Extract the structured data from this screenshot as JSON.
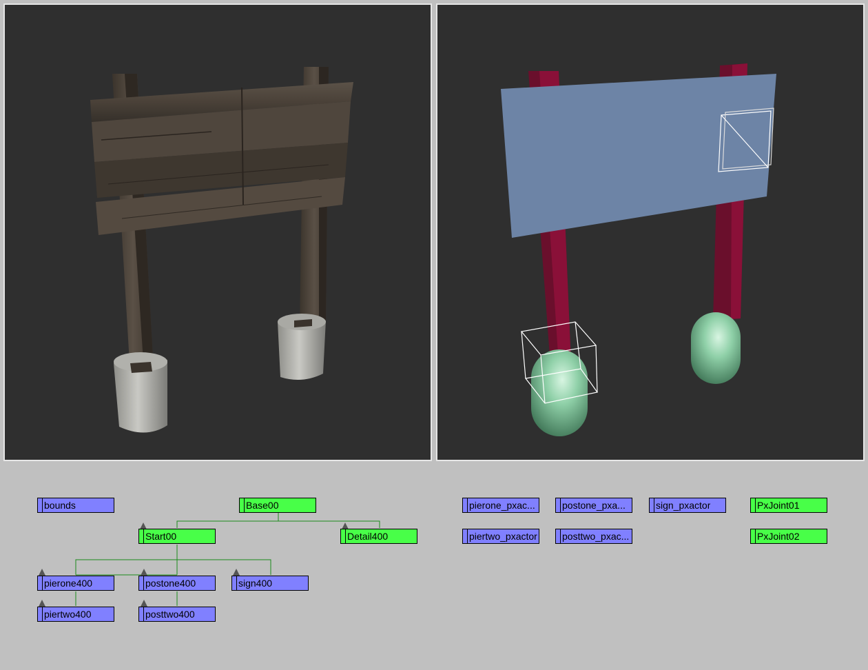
{
  "viewports": {
    "left": {
      "name": "textured-sign-model",
      "shading": "textured"
    },
    "right": {
      "name": "physics-proxy-model",
      "shading": "flat",
      "colors": {
        "panel": "#6d84a6",
        "posts": "#6a0f2c",
        "capsules": "#8fd0a8",
        "selection": "#ffffff"
      }
    }
  },
  "schematic": {
    "hierarchy": [
      {
        "id": "bounds",
        "label": "bounds",
        "type": "blue"
      },
      {
        "id": "base00",
        "label": "Base00",
        "type": "green"
      },
      {
        "id": "start00",
        "label": "Start00",
        "type": "green"
      },
      {
        "id": "detail400",
        "label": "Detail400",
        "type": "green"
      },
      {
        "id": "pierone400",
        "label": "pierone400",
        "type": "blue"
      },
      {
        "id": "postone400",
        "label": "postone400",
        "type": "blue"
      },
      {
        "id": "sign400",
        "label": "sign400",
        "type": "blue"
      },
      {
        "id": "piertwo400",
        "label": "piertwo400",
        "type": "blue"
      },
      {
        "id": "posttwo400",
        "label": "posttwo400",
        "type": "blue"
      }
    ],
    "physics": [
      {
        "id": "pierone-pxactor",
        "label": "pierone_pxac...",
        "type": "blue"
      },
      {
        "id": "postone-pxactor",
        "label": "postone_pxa...",
        "type": "blue"
      },
      {
        "id": "sign-pxactor",
        "label": "sign_pxactor",
        "type": "blue"
      },
      {
        "id": "pxjoint01",
        "label": "PxJoint01",
        "type": "green"
      },
      {
        "id": "piertwo-pxactor",
        "label": "piertwo_pxactor",
        "type": "blue"
      },
      {
        "id": "posttwo-pxactor",
        "label": "posttwo_pxac...",
        "type": "blue"
      },
      {
        "id": "pxjoint02",
        "label": "PxJoint02",
        "type": "green"
      }
    ],
    "colors": {
      "blue_node": "#8080ff",
      "green_node": "#48ff48",
      "link": "#1a8a1a"
    }
  }
}
